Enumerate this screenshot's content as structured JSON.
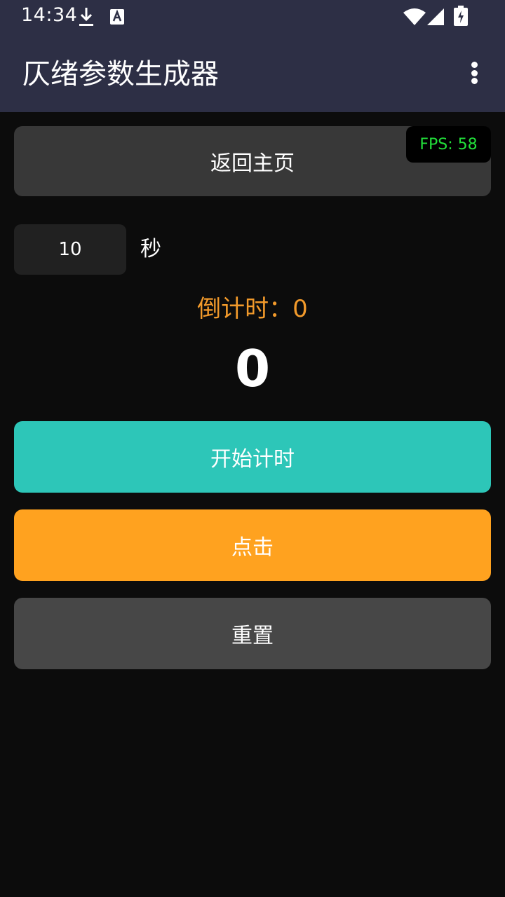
{
  "status_bar": {
    "time": "14:34",
    "icons": [
      "download-icon",
      "a-notification-icon",
      "wifi-icon",
      "signal-icon",
      "battery-charging-icon"
    ]
  },
  "app_bar": {
    "title": "仄绪参数生成器",
    "menu_icon": "more-vert-icon"
  },
  "main": {
    "home_label": "返回主页",
    "fps_label": "FPS: 58",
    "seconds_value": "10",
    "seconds_unit": "秒",
    "countdown_label": "倒计时：",
    "countdown_value": "0",
    "click_count": "0",
    "start_label": "开始计时",
    "click_label": "点击",
    "reset_label": "重置"
  },
  "colors": {
    "app_bar": "#2d2f45",
    "background": "#0c0c0c",
    "start_button": "#2dc6b8",
    "click_button": "#ffa21f",
    "reset_button": "#474747",
    "countdown_text": "#f29a2b",
    "fps_text": "#22e03a"
  }
}
